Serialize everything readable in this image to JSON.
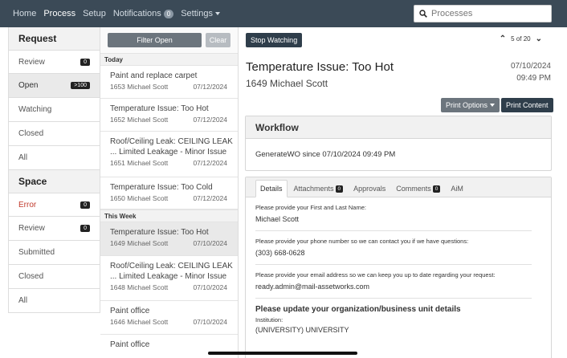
{
  "nav": {
    "items": [
      {
        "label": "Home"
      },
      {
        "label": "Process"
      },
      {
        "label": "Setup"
      },
      {
        "label": "Notifications"
      },
      {
        "label": "Settings"
      }
    ],
    "notifications_count": "0",
    "search_placeholder": "Processes"
  },
  "sidebar": {
    "request_header": "Request",
    "request_items": [
      {
        "label": "Review",
        "count": "0"
      },
      {
        "label": "Open",
        "count": ">100"
      },
      {
        "label": "Watching",
        "count": ""
      },
      {
        "label": "Closed",
        "count": ""
      },
      {
        "label": "All",
        "count": ""
      }
    ],
    "space_header": "Space",
    "space_items": [
      {
        "label": "Error",
        "count": "0"
      },
      {
        "label": "Review",
        "count": "0"
      },
      {
        "label": "Submitted",
        "count": ""
      },
      {
        "label": "Closed",
        "count": ""
      },
      {
        "label": "All",
        "count": ""
      }
    ]
  },
  "list": {
    "filter_label": "Filter Open",
    "clear_label": "Clear",
    "group_today": "Today",
    "group_week": "This Week",
    "today": [
      {
        "title": "Paint and replace carpet",
        "sub": "1653 Michael Scott",
        "date": "07/12/2024"
      },
      {
        "title": "Temperature Issue: Too Hot",
        "sub": "1652 Michael Scott",
        "date": "07/12/2024"
      },
      {
        "title": "Roof/Ceiling Leak: CEILING LEAK ... Limited Leakage - Minor Issue",
        "sub": "1651 Michael Scott",
        "date": "07/12/2024"
      },
      {
        "title": "Temperature Issue: Too Cold",
        "sub": "1650 Michael Scott",
        "date": "07/12/2024"
      }
    ],
    "week": [
      {
        "title": "Temperature Issue: Too Hot",
        "sub": "1649 Michael Scott",
        "date": "07/10/2024"
      },
      {
        "title": "Roof/Ceiling Leak: CEILING LEAK ... Limited Leakage - Minor Issue",
        "sub": "1648 Michael Scott",
        "date": "07/10/2024"
      },
      {
        "title": "Paint office",
        "sub": "1646 Michael Scott",
        "date": "07/10/2024"
      },
      {
        "title": "Paint office",
        "sub": "",
        "date": ""
      }
    ]
  },
  "detail": {
    "stop_watching": "Stop Watching",
    "pager": "5 of 20",
    "title": "Temperature Issue: Too Hot",
    "subtitle": "1649 Michael Scott",
    "date": "07/10/2024",
    "time": "09:49 PM",
    "print_options": "Print Options",
    "print_content": "Print Content",
    "workflow_header": "Workflow",
    "workflow_text": "GenerateWO since 07/10/2024 09:49 PM",
    "tabs": [
      {
        "label": "Details",
        "count": ""
      },
      {
        "label": "Attachments",
        "count": "0"
      },
      {
        "label": "Approvals",
        "count": ""
      },
      {
        "label": "Comments",
        "count": "0"
      },
      {
        "label": "AiM",
        "count": ""
      }
    ],
    "fields": [
      {
        "label": "Please provide your First and Last Name:",
        "value": "Michael Scott"
      },
      {
        "label": "Please provide your phone number so we can contact you if we have questions:",
        "value": "(303) 668-0628"
      },
      {
        "label": "Please provide your email address so we can keep you up to date regarding your request:",
        "value": "ready.admin@mail-assetworks.com"
      }
    ],
    "section_title": "Please update your organization/business unit details",
    "institution_label": "Institution:",
    "institution_value": "(UNIVERSITY) UNIVERSITY"
  }
}
